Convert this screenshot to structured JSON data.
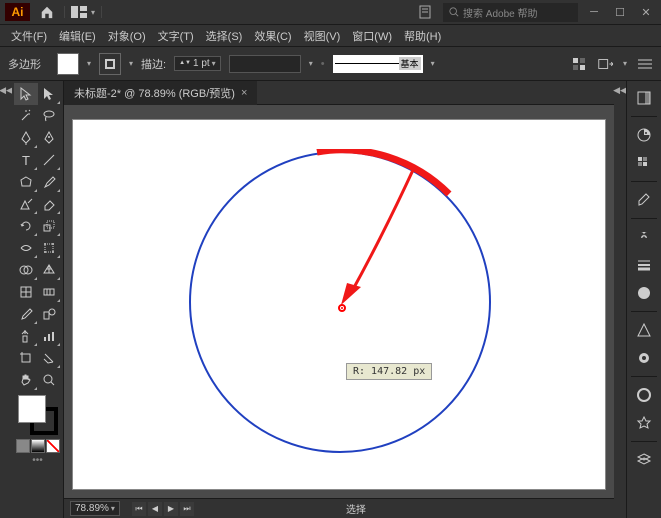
{
  "titlebar": {
    "app_abbr": "Ai",
    "search_placeholder": "搜索 Adobe 帮助"
  },
  "menubar": {
    "file": "文件(F)",
    "edit": "编辑(E)",
    "object": "对象(O)",
    "type": "文字(T)",
    "select": "选择(S)",
    "effect": "效果(C)",
    "view": "视图(V)",
    "window": "窗口(W)",
    "help": "帮助(H)"
  },
  "controlbar": {
    "tool_name": "多边形",
    "stroke_label": "描边:",
    "stroke_value": "1 pt",
    "style_label": "基本"
  },
  "document": {
    "tab_title": "未标题-2* @ 78.89% (RGB/预览)",
    "radius_tooltip": "R: 147.82 px"
  },
  "statusbar": {
    "zoom": "78.89%",
    "mode_label": "选择"
  },
  "chart_data": {
    "type": "circle-drawing",
    "radius_px": 147.82,
    "stroke_color_main": "#2040c0",
    "arc_color": "#f01818",
    "annotation_arrow_color": "#f01818"
  }
}
